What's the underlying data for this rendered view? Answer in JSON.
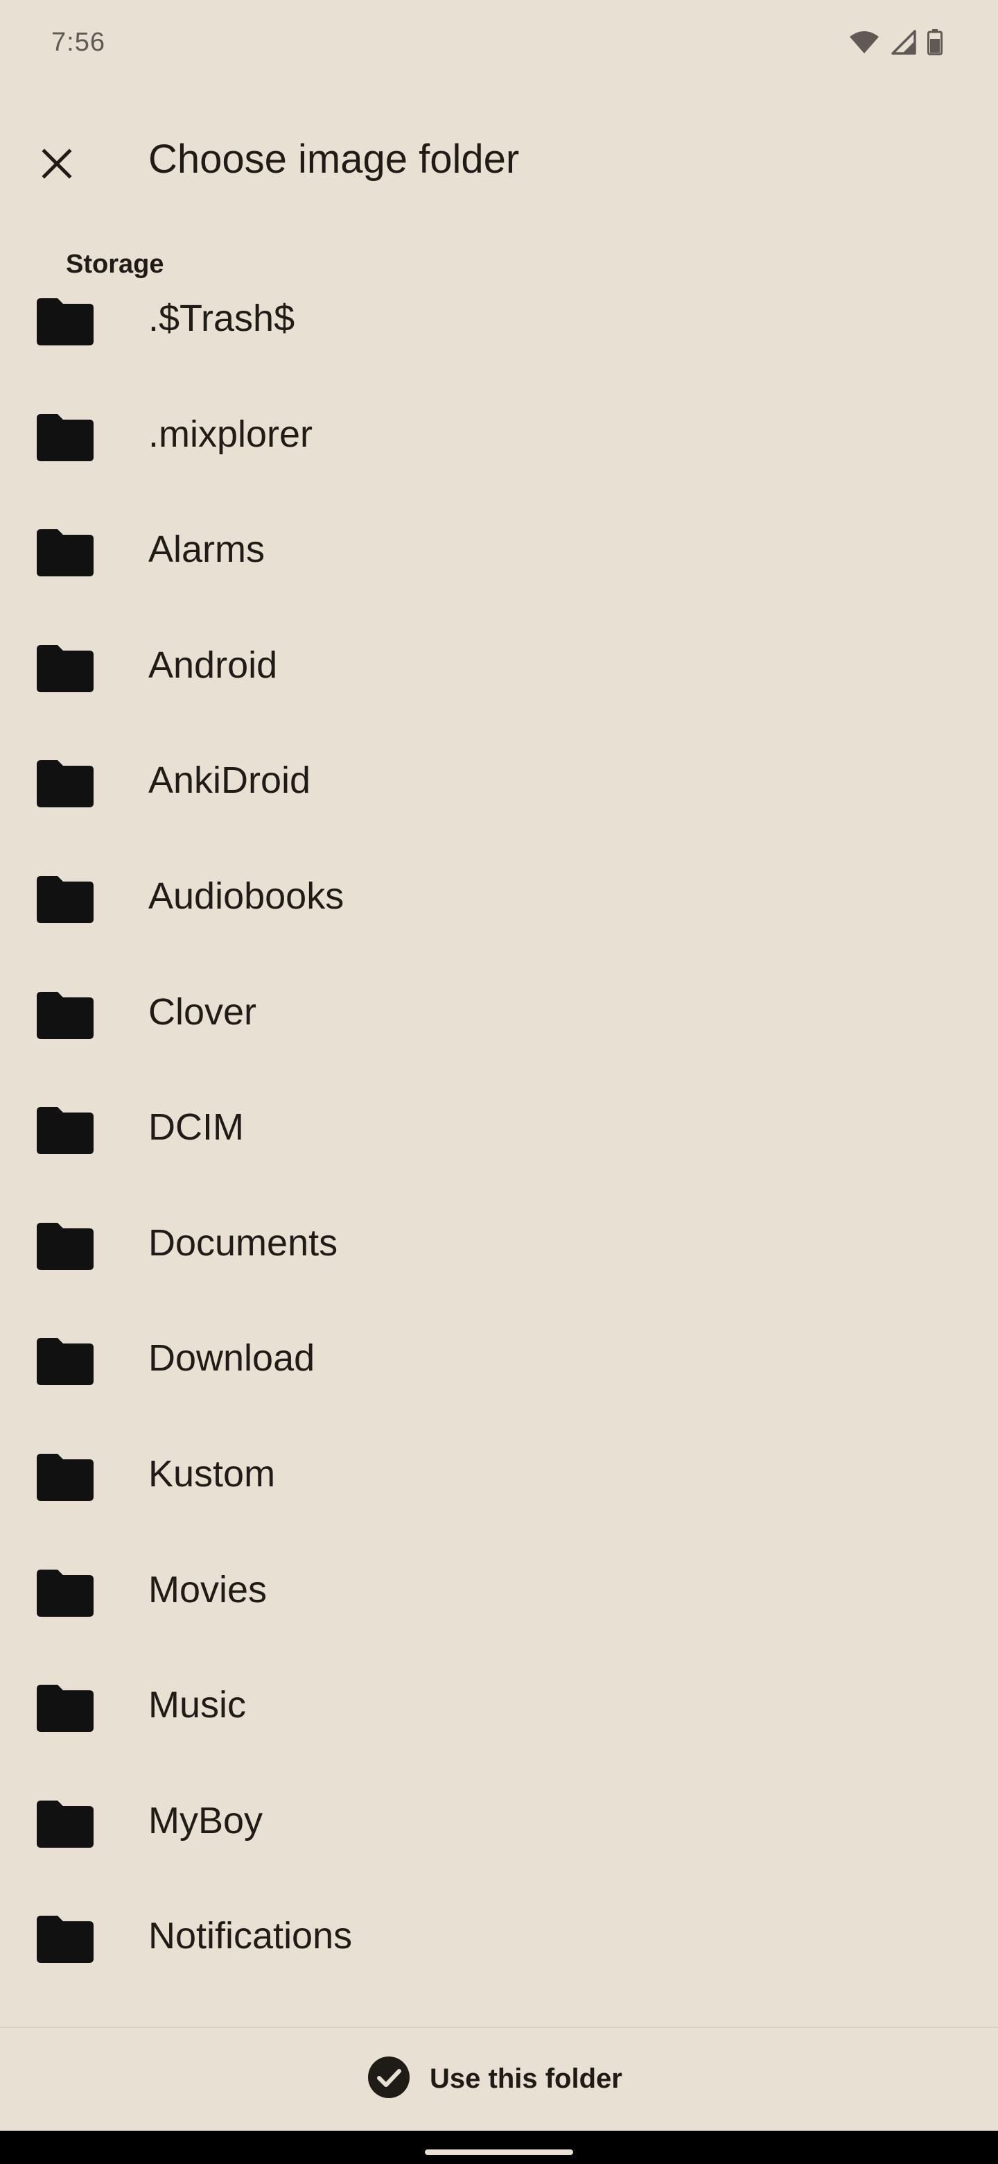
{
  "status_bar": {
    "time": "7:56",
    "icons": [
      "wifi-icon",
      "cellular-signal-icon",
      "battery-icon"
    ]
  },
  "app_bar": {
    "title": "Choose image folder",
    "close_icon": "close-icon"
  },
  "section": {
    "header": "Storage"
  },
  "folders": [
    {
      "label": ".$Trash$",
      "icon": "folder-icon"
    },
    {
      "label": ".mixplorer",
      "icon": "folder-icon"
    },
    {
      "label": "Alarms",
      "icon": "folder-icon"
    },
    {
      "label": "Android",
      "icon": "folder-icon"
    },
    {
      "label": "AnkiDroid",
      "icon": "folder-icon"
    },
    {
      "label": "Audiobooks",
      "icon": "folder-icon"
    },
    {
      "label": "Clover",
      "icon": "folder-icon"
    },
    {
      "label": "DCIM",
      "icon": "folder-icon"
    },
    {
      "label": "Documents",
      "icon": "folder-icon"
    },
    {
      "label": "Download",
      "icon": "folder-icon"
    },
    {
      "label": "Kustom",
      "icon": "folder-icon"
    },
    {
      "label": "Movies",
      "icon": "folder-icon"
    },
    {
      "label": "Music",
      "icon": "folder-icon"
    },
    {
      "label": "MyBoy",
      "icon": "folder-icon"
    },
    {
      "label": "Notifications",
      "icon": "folder-icon"
    }
  ],
  "bottom_action": {
    "label": "Use this folder",
    "icon": "check-circle-icon"
  },
  "colors": {
    "background": "#e9e0d4",
    "text": "#1f1b16",
    "icon": "#111111",
    "nav_bar": "#000000"
  }
}
